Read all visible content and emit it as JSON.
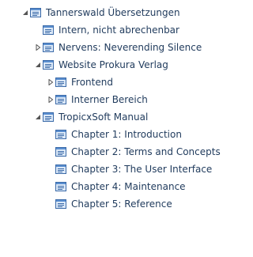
{
  "tree": {
    "items": [
      {
        "label": "Tannerswald Übersetzungen",
        "depth": 0,
        "state": "expanded",
        "icon": "project-icon"
      },
      {
        "label": "Intern, nicht abrechenbar",
        "depth": 1,
        "state": "leaf",
        "icon": "project-icon"
      },
      {
        "label": "Nervens: Neverending Silence",
        "depth": 1,
        "state": "collapsed",
        "icon": "project-icon"
      },
      {
        "label": "Website Prokura Verlag",
        "depth": 1,
        "state": "expanded",
        "icon": "project-icon"
      },
      {
        "label": "Frontend",
        "depth": 2,
        "state": "collapsed",
        "icon": "project-icon"
      },
      {
        "label": "Interner Bereich",
        "depth": 2,
        "state": "collapsed",
        "icon": "project-icon"
      },
      {
        "label": "TropicxSoft Manual",
        "depth": 1,
        "state": "expanded",
        "icon": "project-icon"
      },
      {
        "label": "Chapter 1: Introduction",
        "depth": 2,
        "state": "leaf",
        "icon": "project-icon"
      },
      {
        "label": "Chapter 2: Terms and Concepts",
        "depth": 2,
        "state": "leaf",
        "icon": "project-icon"
      },
      {
        "label": "Chapter 3: The User Interface",
        "depth": 2,
        "state": "leaf",
        "icon": "project-icon"
      },
      {
        "label": "Chapter 4: Maintenance",
        "depth": 2,
        "state": "leaf",
        "icon": "project-icon"
      },
      {
        "label": "Chapter 5: Reference",
        "depth": 2,
        "state": "leaf",
        "icon": "project-icon"
      }
    ]
  },
  "colors": {
    "text": "#1f3a5c",
    "icon_border": "#3b6aa8",
    "icon_fill": "#dbe8f7",
    "icon_header": "#5b8fd0",
    "toggle": "#555555"
  }
}
